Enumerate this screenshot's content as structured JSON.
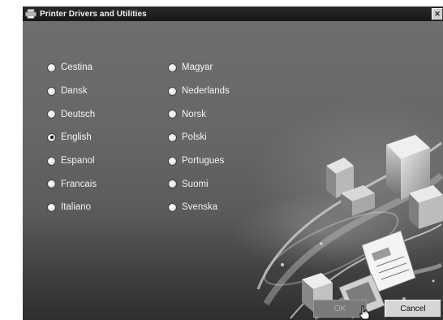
{
  "window": {
    "title": "Printer Drivers and Utilities",
    "close_label": "✕"
  },
  "languages": [
    {
      "label": "Cestina",
      "selected": false
    },
    {
      "label": "Dansk",
      "selected": false
    },
    {
      "label": "Deutsch",
      "selected": false
    },
    {
      "label": "English",
      "selected": true
    },
    {
      "label": "Espanol",
      "selected": false
    },
    {
      "label": "Francais",
      "selected": false
    },
    {
      "label": "Italiano",
      "selected": false
    },
    {
      "label": "Magyar",
      "selected": false
    },
    {
      "label": "Nederlands",
      "selected": false
    },
    {
      "label": "Norsk",
      "selected": false
    },
    {
      "label": "Polski",
      "selected": false
    },
    {
      "label": "Portugues",
      "selected": false
    },
    {
      "label": "Suomi",
      "selected": false
    },
    {
      "label": "Svenska",
      "selected": false
    }
  ],
  "buttons": {
    "ok": "OK",
    "cancel": "Cancel"
  },
  "icons": {
    "app": "printer-icon",
    "close": "close-icon",
    "cursor": "hand-pointer-icon"
  }
}
